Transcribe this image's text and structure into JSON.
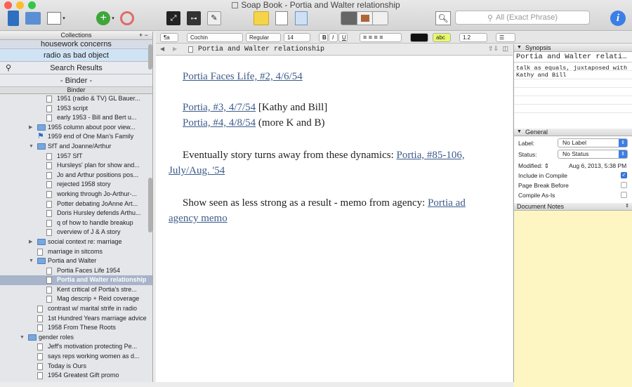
{
  "window": {
    "title": "Soap Book - Portia and Walter relationship"
  },
  "toolbar": {
    "search_placeholder": "All (Exact Phrase)"
  },
  "format_bar": {
    "style": "¶a",
    "font": "Cochin",
    "weight": "Regular",
    "size": "14",
    "bold": "B",
    "italic": "I",
    "underline": "U",
    "highlight": "abc",
    "line_spacing": "1.2",
    "list": "☰"
  },
  "sidebar": {
    "collections_label": "Collections",
    "tabs": [
      "housework concerns",
      "radio as bad object",
      "Search Results",
      "- Binder -"
    ],
    "binder_label": "Binder",
    "items": [
      {
        "label": "1951 (radio & TV) GL Bauer...",
        "type": "doc",
        "indent": 2
      },
      {
        "label": "1953 script",
        "type": "doc",
        "indent": 2
      },
      {
        "label": "early 1953 -  Bill and Bert u...",
        "type": "doc",
        "indent": 2
      },
      {
        "label": "1955 column about poor view...",
        "type": "folder",
        "indent": 1,
        "disc": "▶"
      },
      {
        "label": "1959 end of One Man's Family",
        "type": "flag",
        "indent": 1
      },
      {
        "label": "SfT and Joanne/Arthur",
        "type": "folder",
        "indent": 1,
        "disc": "▼"
      },
      {
        "label": "1957 SfT",
        "type": "doc",
        "indent": 2
      },
      {
        "label": "Hursleys' plan for show and...",
        "type": "doc",
        "indent": 2
      },
      {
        "label": "Jo and Arthur positions pos...",
        "type": "doc",
        "indent": 2
      },
      {
        "label": "rejected 1958 story",
        "type": "doc",
        "indent": 2
      },
      {
        "label": "working through Jo-Arthur-...",
        "type": "doc",
        "indent": 2
      },
      {
        "label": "Potter debating JoAnne Art...",
        "type": "doc",
        "indent": 2
      },
      {
        "label": "Doris Hursley defends Arthu...",
        "type": "doc",
        "indent": 2
      },
      {
        "label": "q of how to handle breakup",
        "type": "doc",
        "indent": 2
      },
      {
        "label": "overview of J & A story",
        "type": "doc",
        "indent": 2
      },
      {
        "label": "social context re: marriage",
        "type": "folder",
        "indent": 1,
        "disc": "▶"
      },
      {
        "label": "marriage in sitcoms",
        "type": "doc",
        "indent": 1
      },
      {
        "label": "Portia and Walter",
        "type": "folder",
        "indent": 1,
        "disc": "▼"
      },
      {
        "label": "Portia Faces Life 1954",
        "type": "doc",
        "indent": 2
      },
      {
        "label": "Portia and Walter relationship",
        "type": "doc",
        "indent": 2,
        "selected": true
      },
      {
        "label": "Kent critical of Portia's stre...",
        "type": "doc",
        "indent": 2
      },
      {
        "label": "Mag descrip + Reid coverage",
        "type": "doc",
        "indent": 2
      },
      {
        "label": "contrast w/ marital strife in radio",
        "type": "doc",
        "indent": 1
      },
      {
        "label": "1st Hundred Years marriage advice",
        "type": "doc",
        "indent": 1
      },
      {
        "label": "1958 From These Roots",
        "type": "doc",
        "indent": 1
      },
      {
        "label": "gender roles",
        "type": "folder",
        "indent": 0,
        "disc": "▼"
      },
      {
        "label": "Jeff's motivation protecting Pe...",
        "type": "doc",
        "indent": 1
      },
      {
        "label": "says reps working women as d...",
        "type": "doc",
        "indent": 1
      },
      {
        "label": "Today is Ours",
        "type": "doc",
        "indent": 1
      },
      {
        "label": "1954 Greatest Gift promo",
        "type": "doc",
        "indent": 1
      }
    ]
  },
  "editor": {
    "header_title": "Portia and Walter relationship",
    "p1_link": "Portia Faces Life, #2, 4/6/54",
    "p2_link": "Portia, #3, 4/7/54",
    "p2_text": " [Kathy and Bill]",
    "p3_link": "Portia, #4, 4/8/54",
    "p3_text": " (more K and B)",
    "p4_text": "Eventually story turns away from these dynamics: ",
    "p4_link_a": "Portia, #85-106,",
    "p4_link_b": "July/Aug. '54",
    "p5_text": "Show seen as less strong as a result - memo from agency: ",
    "p5_link_a": "Portia ad",
    "p5_link_b": "agency memo"
  },
  "inspector": {
    "synopsis_label": "Synopsis",
    "synopsis_title": "Portia and Walter relati…",
    "synopsis_text": "talk as equals, juxtaposed with Kathy and Bill",
    "general_label": "General",
    "label_key": "Label:",
    "label_value": "No Label",
    "status_key": "Status:",
    "status_value": "No Status",
    "modified_key": "Modified:",
    "modified_value": "Aug 6, 2013, 5:38 PM",
    "include_compile": "Include in Compile",
    "page_break": "Page Break Before",
    "compile_as_is": "Compile As-Is",
    "notes_label": "Document Notes"
  },
  "colors": {
    "accent": "#3b7ee6",
    "notes_bg": "#fdf6c3",
    "link": "#3c5c8a"
  }
}
